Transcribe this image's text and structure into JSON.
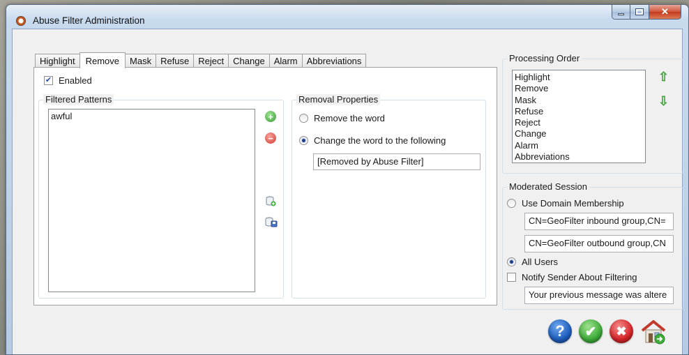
{
  "window": {
    "title": "Abuse Filter Administration"
  },
  "tabs": [
    {
      "label": "Highlight"
    },
    {
      "label": "Remove"
    },
    {
      "label": "Mask"
    },
    {
      "label": "Refuse"
    },
    {
      "label": "Reject"
    },
    {
      "label": "Change"
    },
    {
      "label": "Alarm"
    },
    {
      "label": "Abbreviations"
    }
  ],
  "active_tab": "Remove",
  "remove_tab": {
    "enabled_label": "Enabled",
    "enabled_checked": true,
    "filtered_patterns": {
      "title": "Filtered Patterns",
      "items": [
        "awful"
      ]
    },
    "removal_properties": {
      "title": "Removal Properties",
      "option_remove": "Remove the word",
      "option_change": "Change the word to the following",
      "selected": "change",
      "replacement_value": "[Removed by Abuse Filter]"
    }
  },
  "processing_order": {
    "title": "Processing Order",
    "items": [
      "Highlight",
      "Remove",
      "Mask",
      "Refuse",
      "Reject",
      "Change",
      "Alarm",
      "Abbreviations"
    ]
  },
  "moderated_session": {
    "title": "Moderated Session",
    "use_domain_membership": "Use Domain Membership",
    "inbound_group": "CN=GeoFilter inbound group,CN=",
    "outbound_group": "CN=GeoFilter outbound group,CN",
    "all_users": "All Users",
    "selected": "all_users",
    "notify_sender": "Notify Sender About Filtering",
    "notify_checked": false,
    "notify_message": "Your previous message was altere"
  },
  "icons": {
    "add": "add-icon",
    "remove": "remove-icon",
    "import": "import-icon",
    "export": "export-icon",
    "move_up": "arrow-up-icon",
    "move_down": "arrow-down-icon",
    "help": "help-icon",
    "ok": "ok-icon",
    "cancel": "cancel-icon",
    "home": "home-icon"
  },
  "colors": {
    "accent_blue": "#1f5fbf",
    "ok_green": "#3fae3a",
    "cancel_red": "#d8262a",
    "add_green": "#4db24a",
    "remove_red": "#e04b47"
  }
}
